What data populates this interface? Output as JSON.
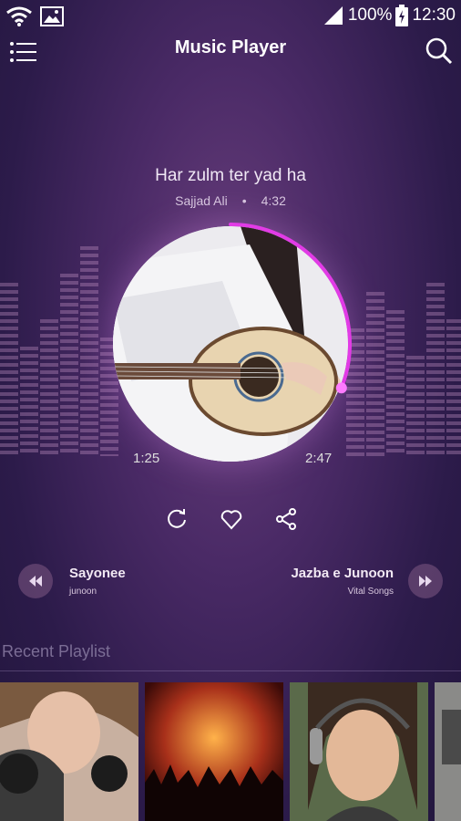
{
  "status_bar": {
    "battery": "100%",
    "time": "12:30"
  },
  "header": {
    "title": "Music Player"
  },
  "now_playing": {
    "title": "Har zulm ter yad ha",
    "artist": "Sajjad Ali",
    "separator": "•",
    "duration": "4:32",
    "elapsed": "1:25",
    "remaining": "2:47",
    "progress_fraction": 0.31
  },
  "previous_track": {
    "title": "Sayonee",
    "artist": "junoon"
  },
  "next_track": {
    "title": "Jazba e Junoon",
    "artist": "Vital Songs"
  },
  "playlist_section": {
    "title": "Recent Playlist"
  },
  "colors": {
    "accent": "#e23be6",
    "background": "#2c1b4a"
  },
  "icons": [
    "wifi-icon",
    "image-icon",
    "signal-icon",
    "battery-icon",
    "menu-icon",
    "search-icon",
    "repeat-icon",
    "heart-icon",
    "share-icon",
    "rewind-icon",
    "fast-forward-icon"
  ]
}
